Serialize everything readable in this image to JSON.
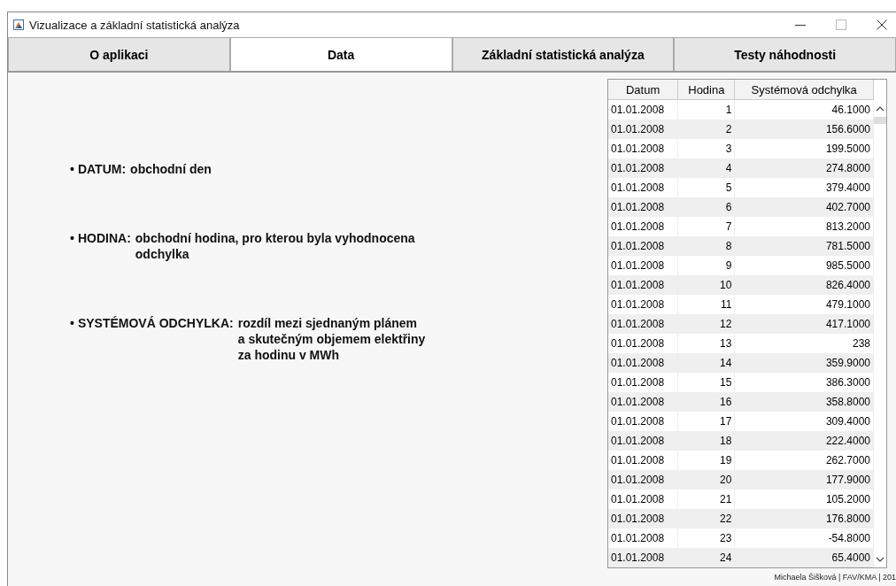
{
  "window": {
    "title": "Vizualizace a základní statistická analýza"
  },
  "tabs": [
    {
      "label": "O aplikaci",
      "selected": false
    },
    {
      "label": "Data",
      "selected": true
    },
    {
      "label": "Základní statistická analýza",
      "selected": false
    },
    {
      "label": "Testy náhodnosti",
      "selected": false
    }
  ],
  "definitions": [
    {
      "bullet": "•",
      "term": "DATUM:",
      "lines": [
        "obchodní den"
      ]
    },
    {
      "bullet": "•",
      "term": "HODINA:",
      "lines": [
        "obchodní hodina, pro kterou byla vyhodnocena",
        "odchylka"
      ]
    },
    {
      "bullet": "•",
      "term": "SYSTÉMOVÁ ODCHYLKA:",
      "lines": [
        "rozdíl mezi sjednaným plánem",
        "a skutečným objemem elektřiny",
        "za hodinu v MWh"
      ]
    }
  ],
  "table": {
    "columns": [
      "Datum",
      "Hodina",
      "Systémová odchylka"
    ],
    "rows": [
      [
        "01.01.2008",
        "1",
        "46.1000"
      ],
      [
        "01.01.2008",
        "2",
        "156.6000"
      ],
      [
        "01.01.2008",
        "3",
        "199.5000"
      ],
      [
        "01.01.2008",
        "4",
        "274.8000"
      ],
      [
        "01.01.2008",
        "5",
        "379.4000"
      ],
      [
        "01.01.2008",
        "6",
        "402.7000"
      ],
      [
        "01.01.2008",
        "7",
        "813.2000"
      ],
      [
        "01.01.2008",
        "8",
        "781.5000"
      ],
      [
        "01.01.2008",
        "9",
        "985.5000"
      ],
      [
        "01.01.2008",
        "10",
        "826.4000"
      ],
      [
        "01.01.2008",
        "11",
        "479.1000"
      ],
      [
        "01.01.2008",
        "12",
        "417.1000"
      ],
      [
        "01.01.2008",
        "13",
        "238"
      ],
      [
        "01.01.2008",
        "14",
        "359.9000"
      ],
      [
        "01.01.2008",
        "15",
        "386.3000"
      ],
      [
        "01.01.2008",
        "16",
        "358.8000"
      ],
      [
        "01.01.2008",
        "17",
        "309.4000"
      ],
      [
        "01.01.2008",
        "18",
        "222.4000"
      ],
      [
        "01.01.2008",
        "19",
        "262.7000"
      ],
      [
        "01.01.2008",
        "20",
        "177.9000"
      ],
      [
        "01.01.2008",
        "21",
        "105.2000"
      ],
      [
        "01.01.2008",
        "22",
        "176.8000"
      ],
      [
        "01.01.2008",
        "23",
        "-54.8000"
      ],
      [
        "01.01.2008",
        "24",
        "65.4000"
      ]
    ]
  },
  "footer": "Michaela Šišková | FAV/KMA | 201"
}
